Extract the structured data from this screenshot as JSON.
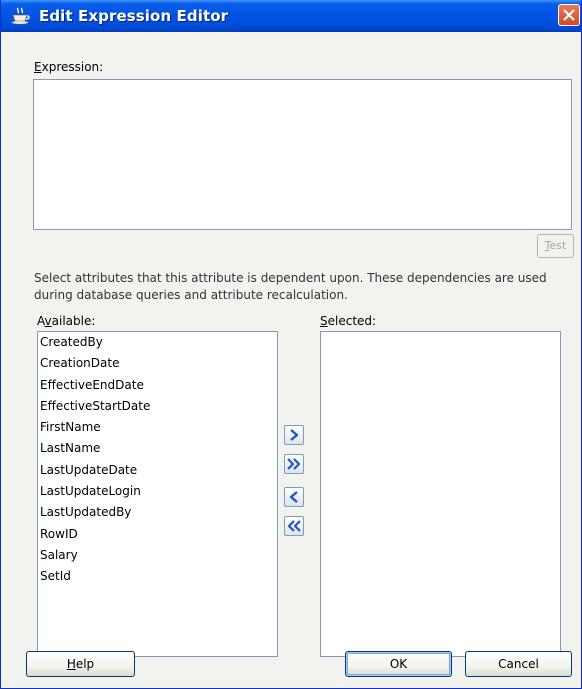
{
  "window": {
    "title": "Edit Expression Editor"
  },
  "expression": {
    "label_mnemonic": "E",
    "label_rest": "xpression:",
    "value": ""
  },
  "test_button": {
    "mnemonic": "T",
    "rest": "est"
  },
  "description": "Select attributes that this attribute is dependent upon. These dependencies are used during database queries and attribute recalculation.",
  "available": {
    "label_before": "A",
    "label_mnemonic": "v",
    "label_after": "ailable:",
    "items": [
      "CreatedBy",
      "CreationDate",
      "EffectiveEndDate",
      "EffectiveStartDate",
      "FirstName",
      "LastName",
      "LastUpdateDate",
      "LastUpdateLogin",
      "LastUpdatedBy",
      "RowID",
      "Salary",
      "SetId"
    ]
  },
  "selected": {
    "label_mnemonic": "S",
    "label_rest": "elected:",
    "items": []
  },
  "shuttle_icons": [
    "move-right-icon",
    "move-all-right-icon",
    "move-left-icon",
    "move-all-left-icon"
  ],
  "buttons": {
    "help_mnemonic": "H",
    "help_rest": "elp",
    "ok": "OK",
    "cancel": "Cancel"
  },
  "colors": {
    "titlebar": "#0054e3",
    "close": "#d34a25",
    "shuttle_arrow": "#1f55c4"
  }
}
